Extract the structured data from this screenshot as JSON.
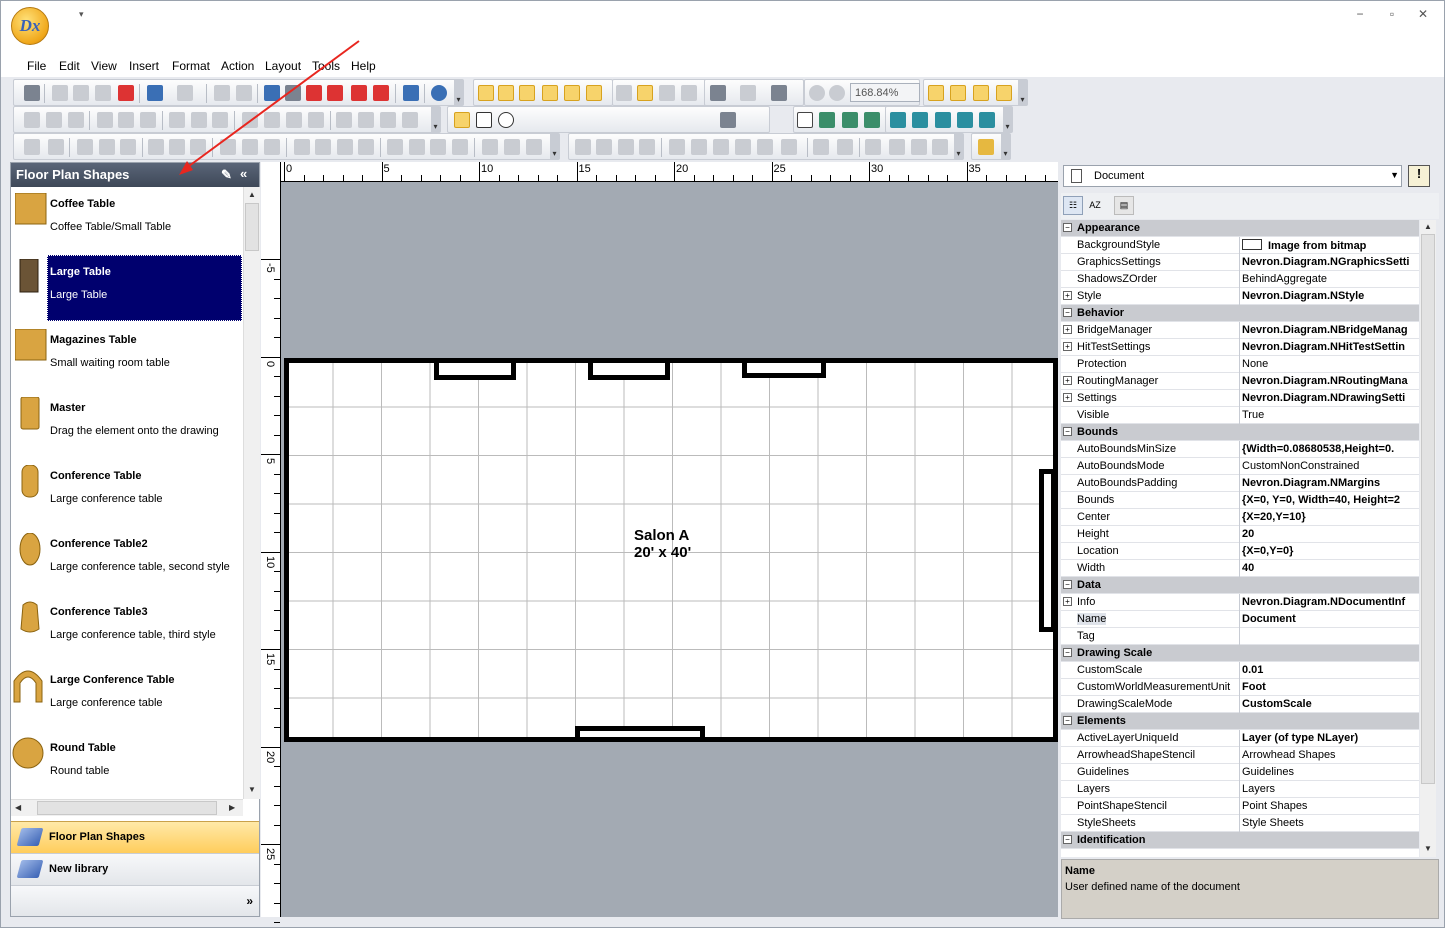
{
  "app": {
    "logo_text": "Dx"
  },
  "window_controls": {
    "minimize": "−",
    "restore": "▫",
    "close": "✕"
  },
  "menu": [
    "File",
    "Edit",
    "View",
    "Insert",
    "Format",
    "Action",
    "Layout",
    "Tools",
    "Help"
  ],
  "toolbar": {
    "zoom_value": "168.84%"
  },
  "left_panel": {
    "title": "Floor Plan Shapes",
    "collapse_glyph": "«",
    "shapes": [
      {
        "name": "Coffee Table",
        "desc": "Coffee Table/Small Table",
        "icon": "coffee-table-icon",
        "selected": false
      },
      {
        "name": "Large Table",
        "desc": "Large Table",
        "icon": "large-table-icon",
        "selected": true
      },
      {
        "name": "Magazines Table",
        "desc": "Small waiting room table",
        "icon": "magazines-table-icon",
        "selected": false
      },
      {
        "name": "Master",
        "desc": "Drag the element onto the drawing",
        "icon": "master-icon",
        "selected": false
      },
      {
        "name": "Conference Table",
        "desc": "Large conference table",
        "icon": "conference-table-icon",
        "selected": false
      },
      {
        "name": "Conference Table2",
        "desc": "Large conference table, second style",
        "icon": "conference-table2-icon",
        "selected": false
      },
      {
        "name": "Conference Table3",
        "desc": "Large conference table, third style",
        "icon": "conference-table3-icon",
        "selected": false
      },
      {
        "name": "Large Conference Table",
        "desc": "Large conference table",
        "icon": "large-conference-table-icon",
        "selected": false
      },
      {
        "name": "Round Table",
        "desc": "Round table",
        "icon": "round-table-icon",
        "selected": false
      }
    ],
    "libraries": [
      {
        "label": "Floor Plan Shapes",
        "active": true
      },
      {
        "label": "New library",
        "active": false
      }
    ],
    "more_glyph": "»"
  },
  "ruler": {
    "top_labels": [
      "0",
      "5",
      "10",
      "15",
      "20",
      "25",
      "30",
      "35"
    ],
    "left_labels": [
      "-5",
      "0",
      "5",
      "10",
      "15",
      "20",
      "25"
    ]
  },
  "drawing": {
    "room_title": "Salon A",
    "room_size": "20' x 40'"
  },
  "properties": {
    "selected_object": "Document",
    "toolbar": [
      "categorized",
      "alphabetical",
      "property-pages"
    ],
    "rows": [
      {
        "type": "cat",
        "name": "Appearance"
      },
      {
        "name": "BackgroundStyle",
        "value": "Image from bitmap",
        "bold": true,
        "swatch": true
      },
      {
        "name": "GraphicsSettings",
        "value": "Nevron.Diagram.NGraphicsSetti",
        "bold": true
      },
      {
        "name": "ShadowsZOrder",
        "value": "BehindAggregate",
        "bold": false
      },
      {
        "name": "Style",
        "value": "Nevron.Diagram.NStyle",
        "bold": true,
        "expand": true
      },
      {
        "type": "cat",
        "name": "Behavior"
      },
      {
        "name": "BridgeManager",
        "value": "Nevron.Diagram.NBridgeManag",
        "bold": true,
        "expand": true
      },
      {
        "name": "HitTestSettings",
        "value": "Nevron.Diagram.NHitTestSettin",
        "bold": true,
        "expand": true
      },
      {
        "name": "Protection",
        "value": "None",
        "bold": false
      },
      {
        "name": "RoutingManager",
        "value": "Nevron.Diagram.NRoutingMana",
        "bold": true,
        "expand": true
      },
      {
        "name": "Settings",
        "value": "Nevron.Diagram.NDrawingSetti",
        "bold": true,
        "expand": true
      },
      {
        "name": "Visible",
        "value": "True",
        "bold": false
      },
      {
        "type": "cat",
        "name": "Bounds"
      },
      {
        "name": "AutoBoundsMinSize",
        "value": "{Width=0.08680538,Height=0.",
        "bold": true
      },
      {
        "name": "AutoBoundsMode",
        "value": "CustomNonConstrained",
        "bold": false
      },
      {
        "name": "AutoBoundsPadding",
        "value": "Nevron.Diagram.NMargins",
        "bold": true
      },
      {
        "name": "Bounds",
        "value": "{X=0, Y=0, Width=40, Height=2",
        "bold": true
      },
      {
        "name": "Center",
        "value": "{X=20,Y=10}",
        "bold": true
      },
      {
        "name": "Height",
        "value": "20",
        "bold": true
      },
      {
        "name": "Location",
        "value": "{X=0,Y=0}",
        "bold": true
      },
      {
        "name": "Width",
        "value": "40",
        "bold": true
      },
      {
        "type": "cat",
        "name": "Data"
      },
      {
        "name": "Info",
        "value": "Nevron.Diagram.NDocumentInf",
        "bold": true,
        "expand": true
      },
      {
        "name": "Name",
        "value": "Document",
        "bold": true,
        "selected": true
      },
      {
        "name": "Tag",
        "value": "",
        "bold": false
      },
      {
        "type": "cat",
        "name": "Drawing Scale"
      },
      {
        "name": "CustomScale",
        "value": "0.01",
        "bold": true
      },
      {
        "name": "CustomWorldMeasurementUnit",
        "value": "Foot",
        "bold": true
      },
      {
        "name": "DrawingScaleMode",
        "value": "CustomScale",
        "bold": true
      },
      {
        "type": "cat",
        "name": "Elements"
      },
      {
        "name": "ActiveLayerUniqueId",
        "value": "Layer (of type NLayer)",
        "bold": true
      },
      {
        "name": "ArrowheadShapeStencil",
        "value": "Arrowhead Shapes",
        "bold": false
      },
      {
        "name": "Guidelines",
        "value": "Guidelines",
        "bold": false
      },
      {
        "name": "Layers",
        "value": "Layers",
        "bold": false
      },
      {
        "name": "PointShapeStencil",
        "value": "Point Shapes",
        "bold": false
      },
      {
        "name": "StyleSheets",
        "value": "Style Sheets",
        "bold": false
      },
      {
        "type": "cat",
        "name": "Identification"
      }
    ],
    "description": {
      "title": "Name",
      "text": "User defined name of the document"
    }
  },
  "colors": {
    "selection": "#00006e",
    "annotation_arrow": "#e8261f",
    "canvas_bg": "#a3aab3"
  }
}
